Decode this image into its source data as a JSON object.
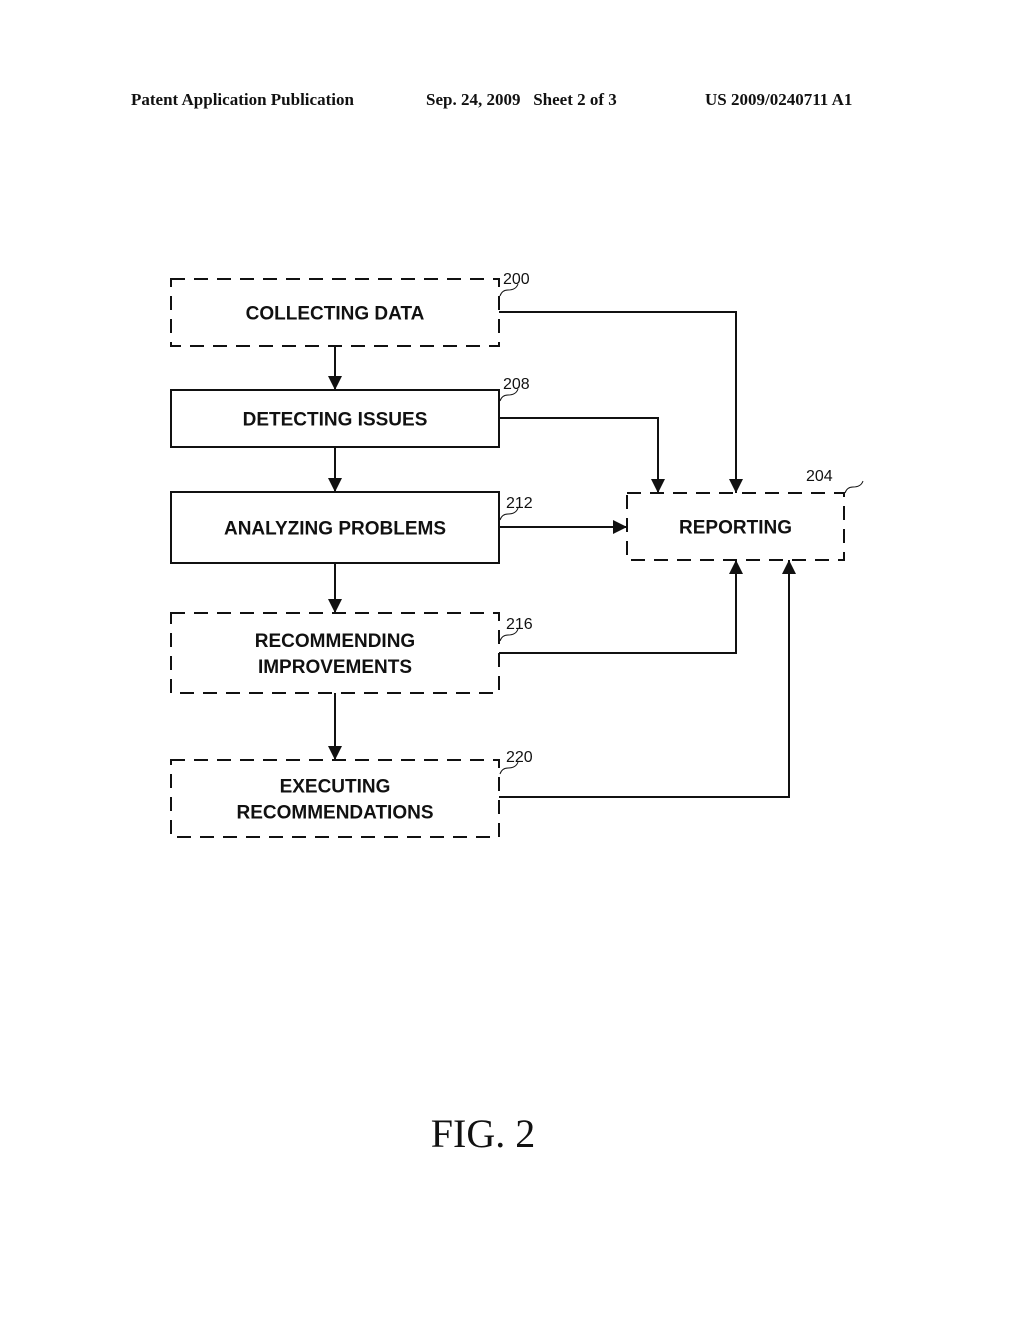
{
  "header": {
    "publication": "Patent Application Publication",
    "date_sheet": "Sep. 24, 2009   Sheet 2 of 3",
    "number": "US 2009/0240711 A1"
  },
  "nodes": [
    {
      "id": "collecting",
      "ref": "200",
      "lines": [
        "COLLECTING DATA"
      ],
      "border": "dashed"
    },
    {
      "id": "detecting",
      "ref": "208",
      "lines": [
        "DETECTING ISSUES"
      ],
      "border": "solid"
    },
    {
      "id": "analyzing",
      "ref": "212",
      "lines": [
        "ANALYZING PROBLEMS"
      ],
      "border": "solid"
    },
    {
      "id": "recommending",
      "ref": "216",
      "lines": [
        "RECOMMENDING",
        "IMPROVEMENTS"
      ],
      "border": "dashed"
    },
    {
      "id": "executing",
      "ref": "220",
      "lines": [
        "EXECUTING",
        "RECOMMENDATIONS"
      ],
      "border": "dashed"
    },
    {
      "id": "reporting",
      "ref": "204",
      "lines": [
        "REPORTING"
      ],
      "border": "dashed"
    }
  ],
  "edges": [
    {
      "from": "collecting",
      "to": "detecting"
    },
    {
      "from": "detecting",
      "to": "analyzing"
    },
    {
      "from": "analyzing",
      "to": "recommending"
    },
    {
      "from": "recommending",
      "to": "executing"
    },
    {
      "from": "collecting",
      "to": "reporting"
    },
    {
      "from": "detecting",
      "to": "reporting"
    },
    {
      "from": "analyzing",
      "to": "reporting"
    },
    {
      "from": "recommending",
      "to": "reporting"
    },
    {
      "from": "executing",
      "to": "reporting"
    }
  ],
  "figure_label": "FIG. 2"
}
